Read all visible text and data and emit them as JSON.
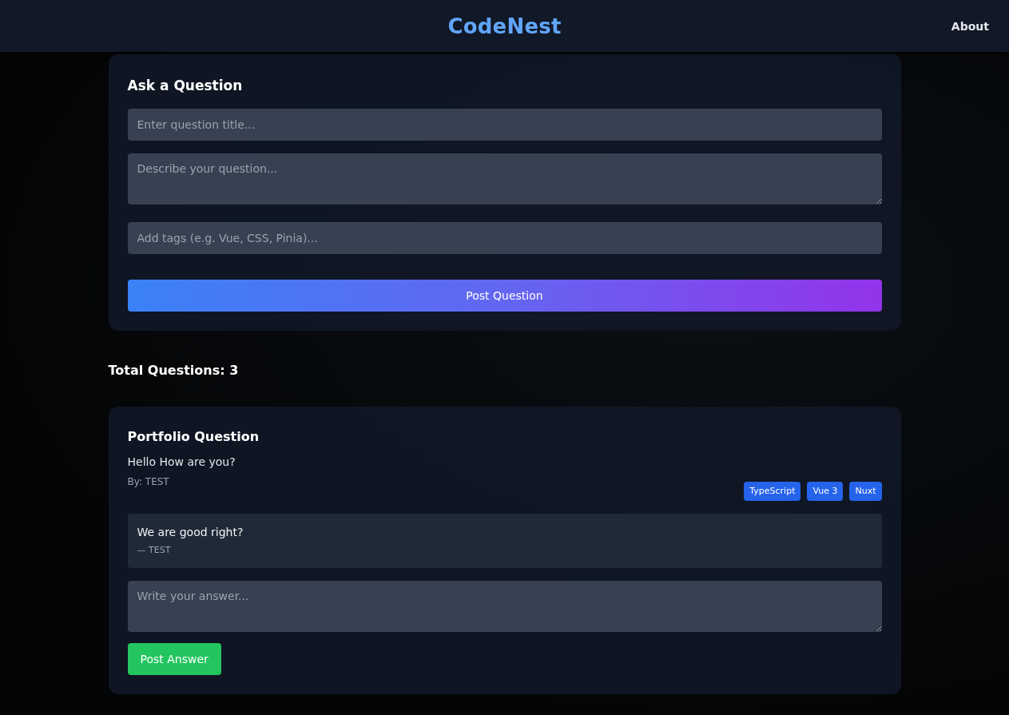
{
  "header": {
    "logo": "CodeNest",
    "nav": [
      {
        "label": "About"
      }
    ]
  },
  "ask_form": {
    "title": "Ask a Question",
    "title_field": {
      "placeholder": "Enter question title..."
    },
    "description_field": {
      "placeholder": "Describe your question..."
    },
    "tags_field": {
      "placeholder": "Add tags (e.g. Vue, CSS, Pinia)..."
    },
    "submit_button": "Post Question"
  },
  "total_questions": "Total Questions: 3",
  "questions": [
    {
      "title": "Portfolio Question",
      "body": "Hello How are you?",
      "author": "By: TEST",
      "tags": [
        "TypeScript",
        "Vue 3",
        "Nuxt"
      ],
      "answers": [
        {
          "text": "We are good right?",
          "author": "— TEST"
        }
      ],
      "answer_field": {
        "placeholder": "Write your answer..."
      },
      "answer_button": "Post Answer"
    }
  ]
}
